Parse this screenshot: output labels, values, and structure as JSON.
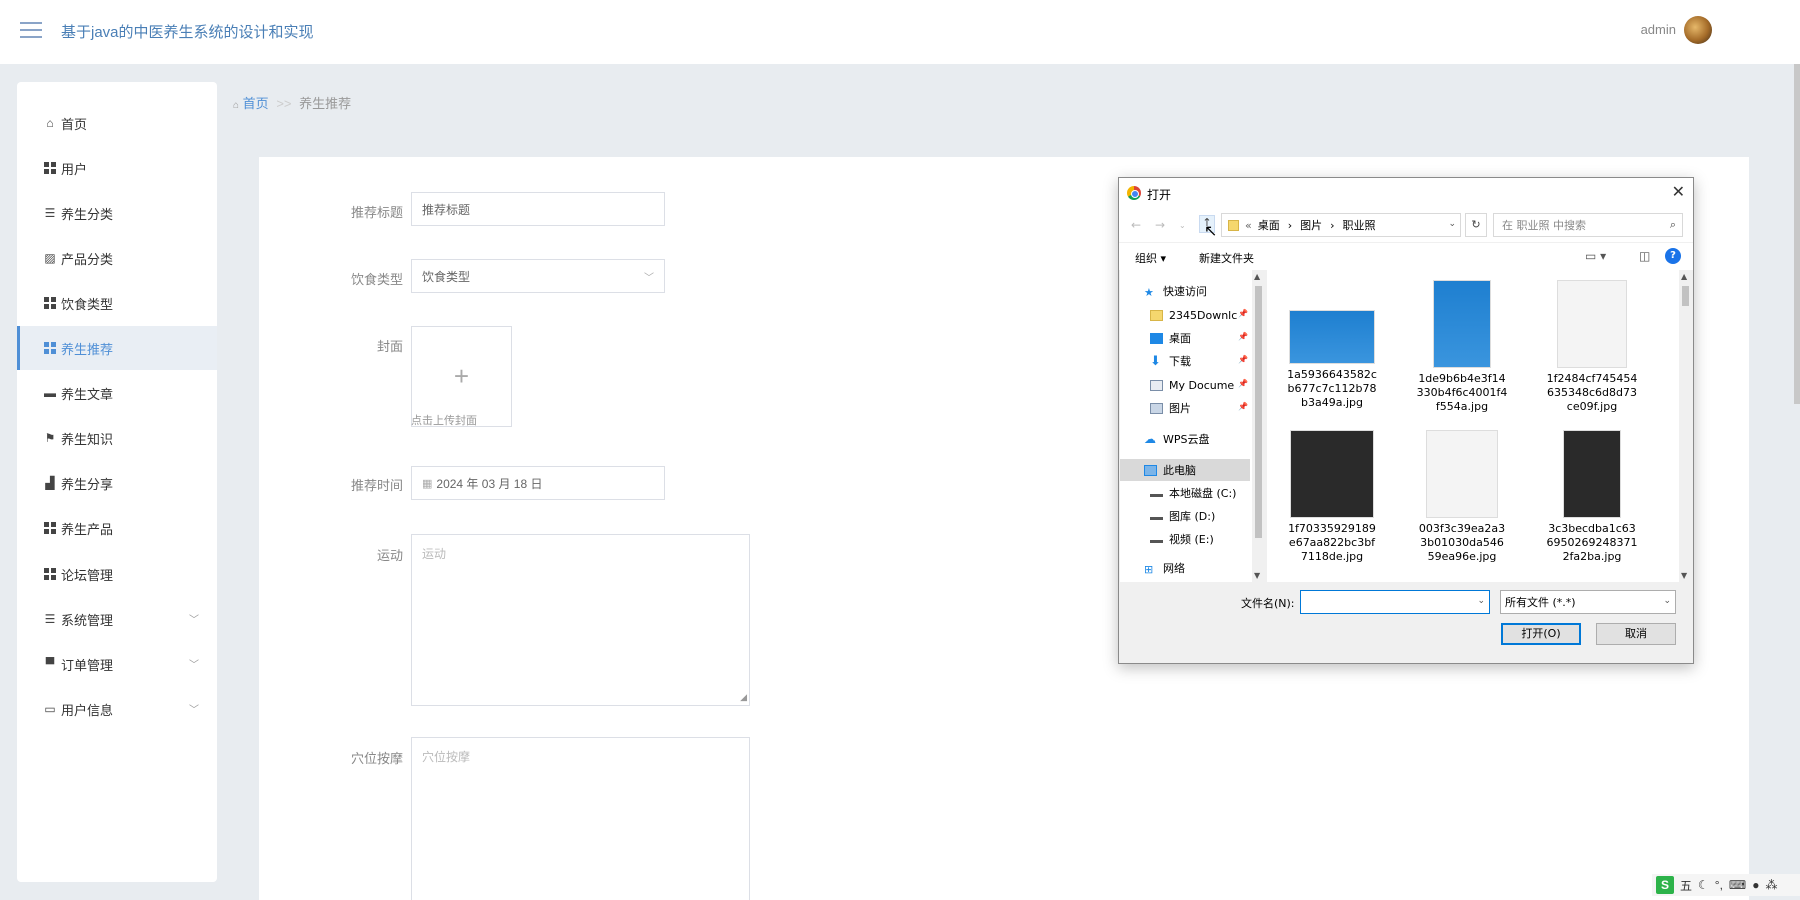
{
  "header": {
    "title": "基于java的中医养生系统的设计和实现",
    "admin": "admin"
  },
  "sidebar": {
    "items": [
      {
        "label": "首页",
        "icon": "home-icon"
      },
      {
        "label": "用户",
        "icon": "grid-icon"
      },
      {
        "label": "养生分类",
        "icon": "sliders-icon"
      },
      {
        "label": "产品分类",
        "icon": "chart-icon"
      },
      {
        "label": "饮食类型",
        "icon": "grid-icon"
      },
      {
        "label": "养生推荐",
        "icon": "grid-icon"
      },
      {
        "label": "养生文章",
        "icon": "car-icon"
      },
      {
        "label": "养生知识",
        "icon": "flag-icon"
      },
      {
        "label": "养生分享",
        "icon": "share-icon"
      },
      {
        "label": "养生产品",
        "icon": "grid-icon"
      },
      {
        "label": "论坛管理",
        "icon": "grid-icon"
      },
      {
        "label": "系统管理",
        "icon": "list-icon"
      },
      {
        "label": "订单管理",
        "icon": "printer-icon"
      },
      {
        "label": "用户信息",
        "icon": "card-icon"
      }
    ],
    "active_index": 5
  },
  "breadcrumb": {
    "home": "首页",
    "sep": ">>",
    "current": "养生推荐"
  },
  "form": {
    "title_label": "推荐标题",
    "title_value": "推荐标题",
    "diet_label": "饮食类型",
    "diet_value": "饮食类型",
    "cover_label": "封面",
    "cover_plus": "+",
    "cover_hint": "点击上传封面",
    "time_label": "推荐时间",
    "time_value": "2024 年 03 月 18 日",
    "sport_label": "运动",
    "sport_placeholder": "运动",
    "acu_label": "穴位按摩",
    "acu_placeholder": "穴位按摩"
  },
  "dialog": {
    "title": "打开",
    "close": "✕",
    "breadcrumb": [
      "桌面",
      "图片",
      "职业照"
    ],
    "search_placeholder": "在 职业照 中搜索",
    "toolbar": {
      "organize": "组织 ▾",
      "new_folder": "新建文件夹"
    },
    "tree": [
      {
        "label": "快速访问",
        "icon": "star-icon",
        "color": "#1e88e5"
      },
      {
        "label": "2345Downlc",
        "icon": "folder-icon",
        "color": "#f5d76e",
        "pinned": true
      },
      {
        "label": "桌面",
        "icon": "desktop-icon",
        "color": "#1e88e5",
        "pinned": true
      },
      {
        "label": "下载",
        "icon": "download-icon",
        "color": "#1e88e5",
        "pinned": true
      },
      {
        "label": "My Docume",
        "icon": "document-icon",
        "color": "#7a8ea8",
        "pinned": true
      },
      {
        "label": "图片",
        "icon": "pictures-icon",
        "color": "#7a8ea8",
        "pinned": true
      },
      {
        "label": "WPS云盘",
        "icon": "cloud-icon",
        "color": "#1e88e5"
      },
      {
        "label": "此电脑",
        "icon": "computer-icon",
        "color": "#1e88e5"
      },
      {
        "label": "本地磁盘 (C:)",
        "icon": "drive-icon",
        "color": "#555555"
      },
      {
        "label": "图库 (D:)",
        "icon": "drive-icon",
        "color": "#555555"
      },
      {
        "label": "视频 (E:)",
        "icon": "drive-icon",
        "color": "#555555"
      },
      {
        "label": "网络",
        "icon": "network-icon",
        "color": "#1e88e5"
      }
    ],
    "files": [
      {
        "name_lines": [
          "1a5936643582c",
          "b677c7c112b78",
          "b3a49a.jpg"
        ],
        "bg": "blue"
      },
      {
        "name_lines": [
          "1de9b6b4e3f14",
          "330b4f6c4001f4",
          "f554a.jpg"
        ],
        "bg": "blue"
      },
      {
        "name_lines": [
          "1f2484cf745454",
          "635348c6d8d73",
          "ce09f.jpg"
        ],
        "bg": "white"
      },
      {
        "name_lines": [
          "1f70335929189",
          "e67aa822bc3bf",
          "7118de.jpg"
        ],
        "bg": "dark"
      },
      {
        "name_lines": [
          "003f3c39ea2a3",
          "3b01030da546",
          "59ea96e.jpg"
        ],
        "bg": "white"
      },
      {
        "name_lines": [
          "3c3becdba1c63",
          "6950269248371",
          "2fa2ba.jpg"
        ],
        "bg": "dark"
      }
    ],
    "filename_label": "文件名(N):",
    "filetype": "所有文件 (*.*)",
    "open_button": "打开(O)",
    "cancel_button": "取消"
  },
  "ime": {
    "logo": "S",
    "mode": "五"
  }
}
